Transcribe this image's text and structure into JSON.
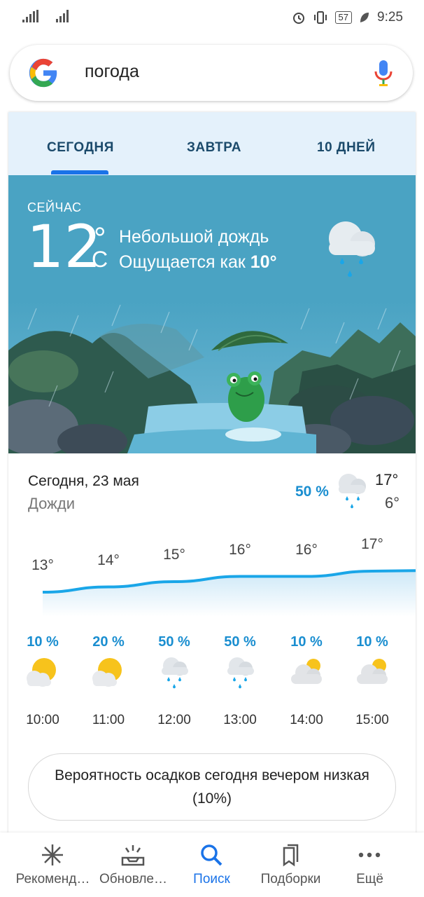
{
  "status_bar": {
    "time": "9:25",
    "battery": "57",
    "icons": [
      "signal-icon",
      "signal-icon",
      "alarm-icon",
      "vibrate-icon",
      "battery-icon",
      "leaf-icon"
    ]
  },
  "search": {
    "query": "погода",
    "icons": [
      "google-logo",
      "mic-icon"
    ]
  },
  "tabs": [
    {
      "label": "СЕГОДНЯ",
      "active": true
    },
    {
      "label": "ЗАВТРА",
      "active": false
    },
    {
      "label": "10 ДНЕЙ",
      "active": false
    }
  ],
  "current": {
    "label": "СЕЙЧАС",
    "temp": "12",
    "degree": "°",
    "unit": "C",
    "condition": "Небольшой дождь",
    "feels_prefix": "Ощущается как ",
    "feels_value": "10°",
    "icon": "rain-cloud-icon"
  },
  "summary": {
    "date": "Сегодня, 23 мая",
    "condition": "Дожди",
    "precip": "50 %",
    "high": "17°",
    "low": "6°",
    "icon": "rain-cloud-icon"
  },
  "hourly": [
    {
      "temp": "13°",
      "temp_value": 13,
      "precip": "10 %",
      "icon": "sun-cloud-icon",
      "time": "10:00"
    },
    {
      "temp": "14°",
      "temp_value": 14,
      "precip": "20 %",
      "icon": "sun-cloud-icon",
      "time": "11:00"
    },
    {
      "temp": "15°",
      "temp_value": 15,
      "precip": "50 %",
      "icon": "rain-cloud-icon",
      "time": "12:00"
    },
    {
      "temp": "16°",
      "temp_value": 16,
      "precip": "50 %",
      "icon": "rain-cloud-icon",
      "time": "13:00"
    },
    {
      "temp": "16°",
      "temp_value": 16,
      "precip": "10 %",
      "icon": "cloud-sun-icon",
      "time": "14:00"
    },
    {
      "temp": "17°",
      "temp_value": 17,
      "precip": "10 %",
      "icon": "cloud-sun-icon",
      "time": "15:00"
    }
  ],
  "precip_note": "Вероятность осадков сегодня вечером низкая (10%)",
  "bottom_nav": [
    {
      "label": "Рекоменд…",
      "icon": "asterisk-icon",
      "active": false
    },
    {
      "label": "Обновле…",
      "icon": "updates-icon",
      "active": false
    },
    {
      "label": "Поиск",
      "icon": "search-icon",
      "active": true
    },
    {
      "label": "Подборки",
      "icon": "collections-icon",
      "active": false
    },
    {
      "label": "Ещё",
      "icon": "more-icon",
      "active": false
    }
  ],
  "colors": {
    "accent": "#1a73e8",
    "precip": "#1a8ed0",
    "hero_bg": "#4aa3c3",
    "tabs_bg": "#e4f1fb"
  }
}
